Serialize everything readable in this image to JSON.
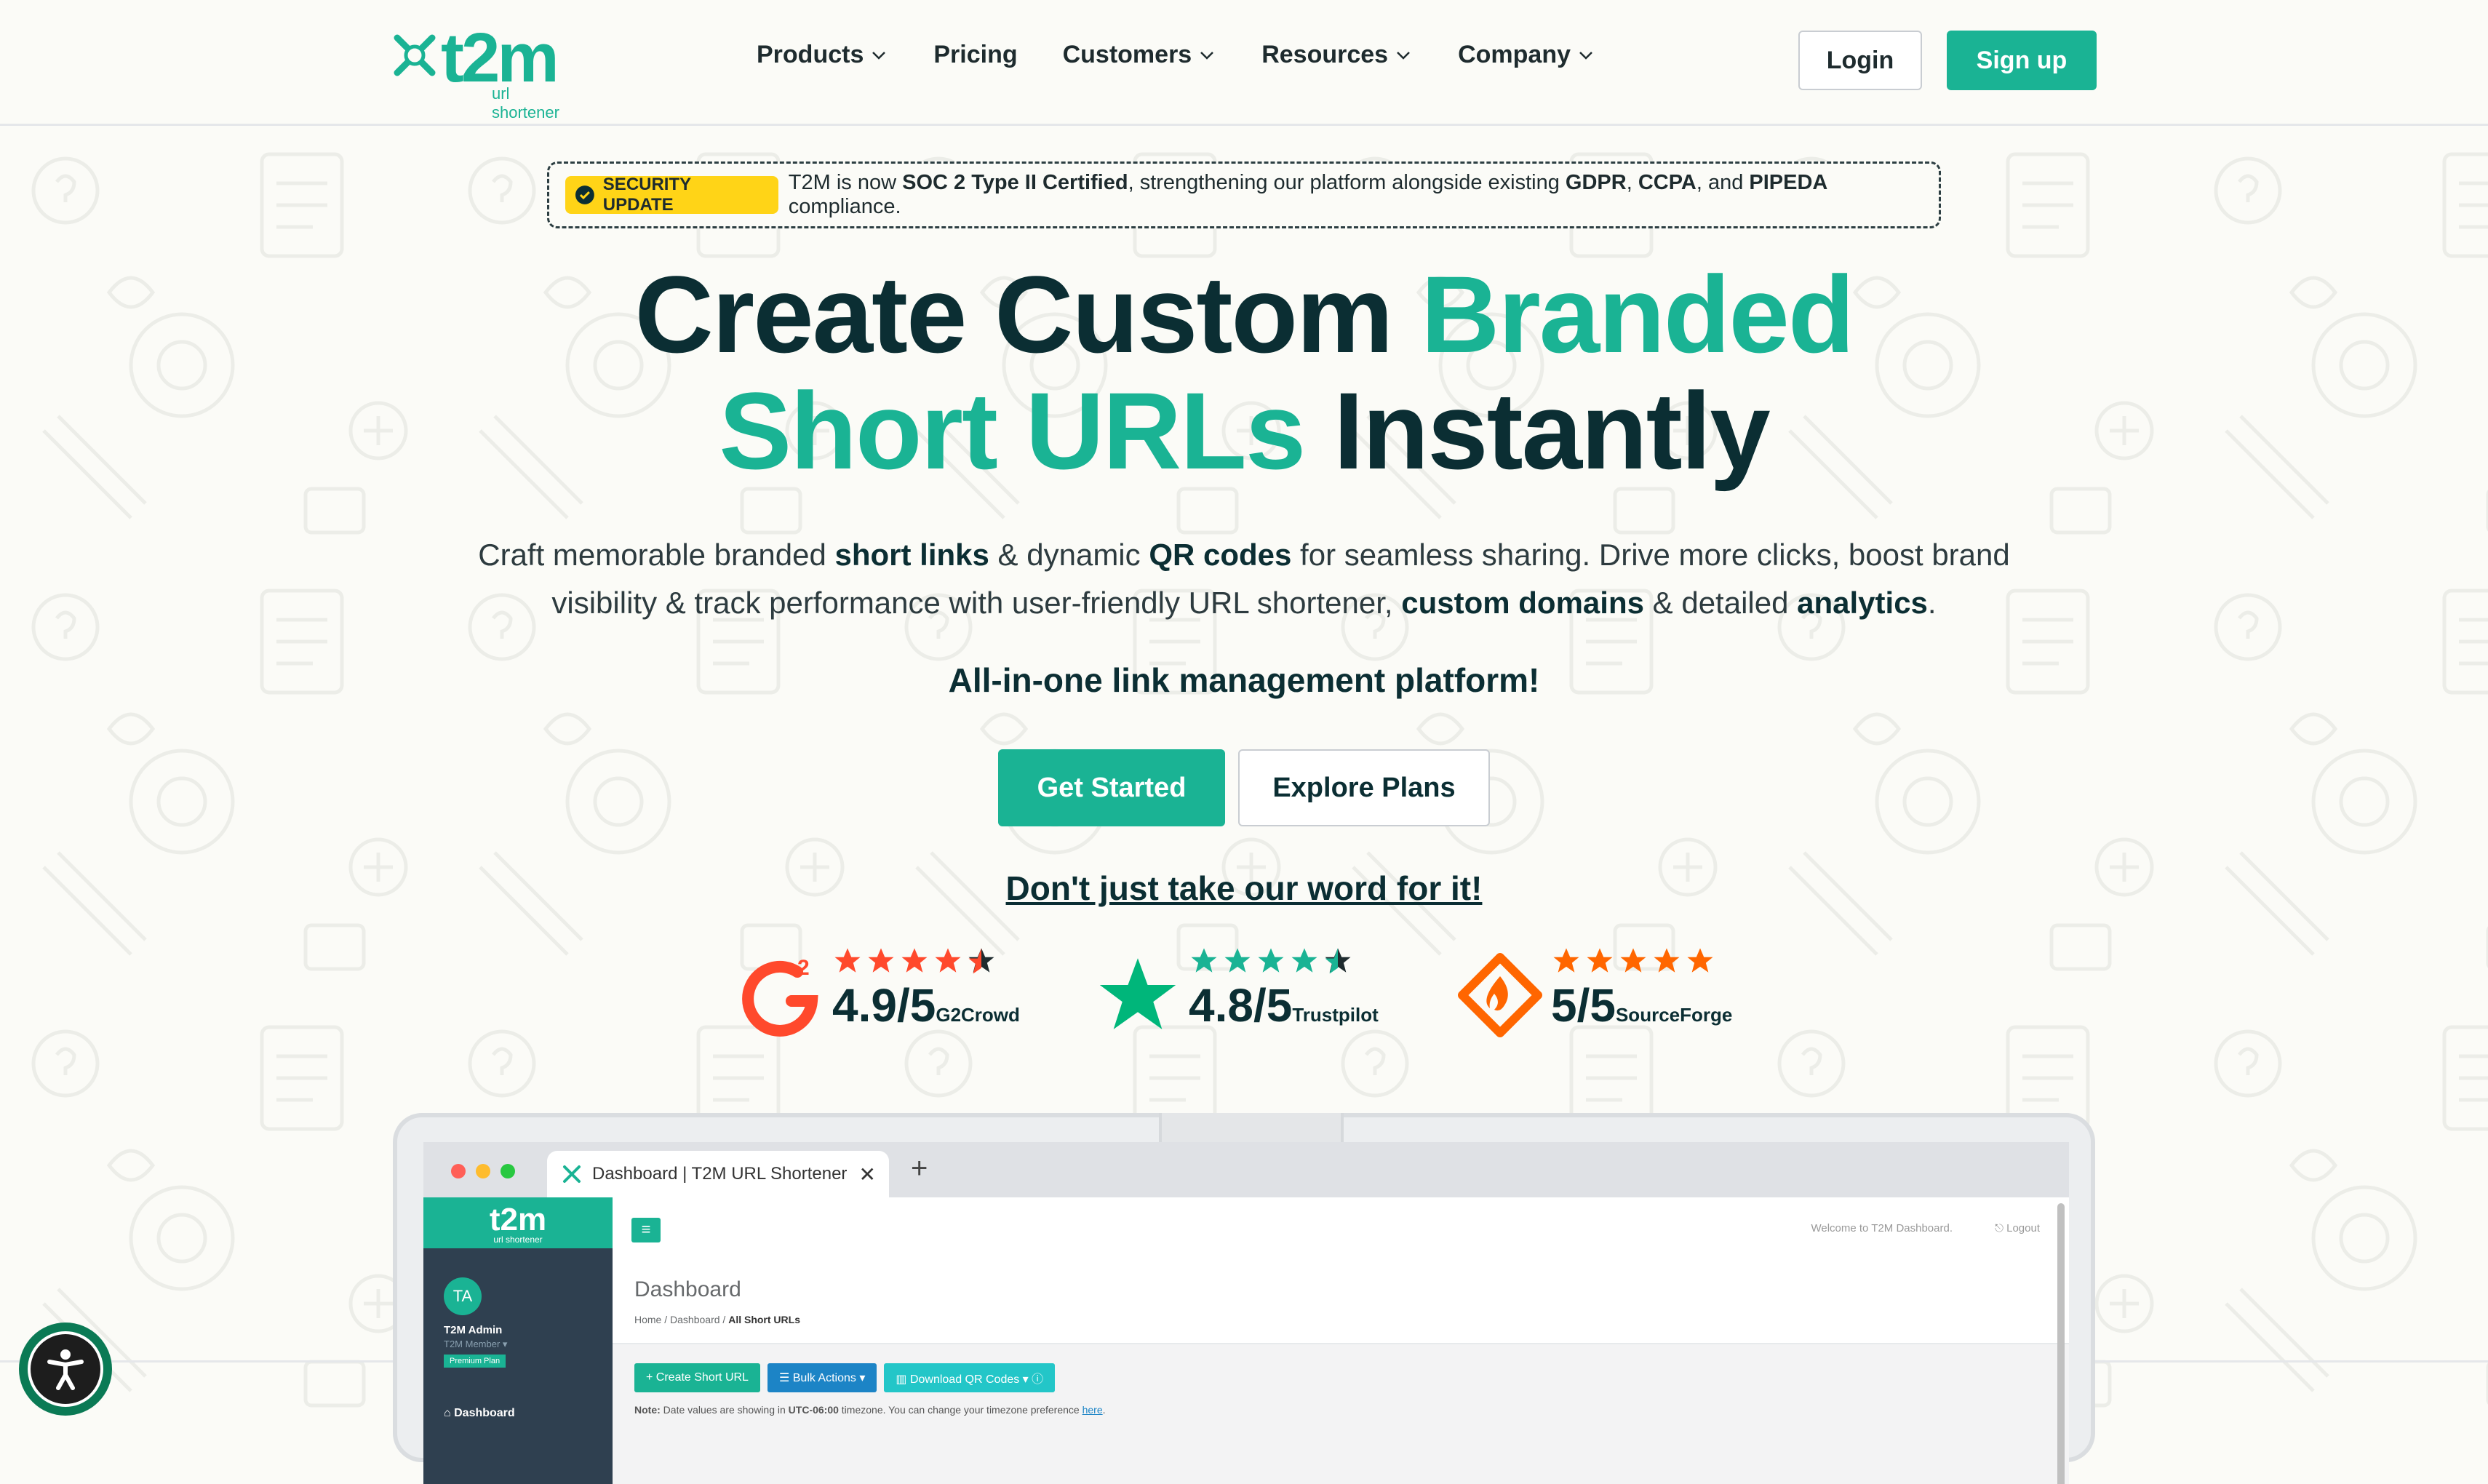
{
  "brand": {
    "name": "t2m",
    "sub": "url shortener",
    "accent": "#1ab394",
    "dark": "#0b2e33"
  },
  "nav": {
    "items": [
      {
        "label": "Products",
        "dropdown": true
      },
      {
        "label": "Pricing",
        "dropdown": false
      },
      {
        "label": "Customers",
        "dropdown": true
      },
      {
        "label": "Resources",
        "dropdown": true
      },
      {
        "label": "Company",
        "dropdown": true
      }
    ],
    "login": "Login",
    "signup": "Sign up"
  },
  "announcement": {
    "badge": "SECURITY UPDATE",
    "t1": "T2M is now ",
    "b1": "SOC 2 Type II Certified",
    "t2": ", strengthening our platform alongside existing ",
    "b2": "GDPR",
    "t3": ", ",
    "b3": "CCPA",
    "t4": ", and ",
    "b4": "PIPEDA",
    "t5": " compliance."
  },
  "hero": {
    "l1a": "Create Custom ",
    "l1b": "Branded",
    "l2a": "Short URLs",
    "l2b": " Instantly",
    "sub": {
      "t1": "Craft memorable branded ",
      "b1": "short links",
      "t2": " & dynamic ",
      "b2": "QR codes",
      "t3": " for seamless sharing. Drive more clicks, boost brand visibility & track performance with user-friendly URL shortener, ",
      "b3": "custom domains",
      "t4": " & detailed ",
      "b4": "analytics",
      "t5": "."
    },
    "tagline": "All-in-one link management platform!",
    "cta_primary": "Get Started",
    "cta_secondary": "Explore Plans",
    "proof_link": "Don't just take our word for it!"
  },
  "ratings": [
    {
      "score": "4.9/5",
      "source": "G2Crowd",
      "logo": "g2-logo-icon",
      "color": "#ff492c"
    },
    {
      "score": "4.8/5",
      "source": "Trustpilot",
      "logo": "trustpilot-star-icon",
      "color": "#00b67a"
    },
    {
      "score": "5/5",
      "source": "SourceForge",
      "logo": "sourceforge-logo-icon",
      "color": "#ff6600"
    }
  ],
  "mockup": {
    "tab_title": "Dashboard | T2M URL Shortener",
    "sidebar": {
      "logo": "t2m",
      "logo_sub": "url shortener",
      "initials": "TA",
      "name": "T2M Admin",
      "member": "T2M Member ▾",
      "plan": "Premium Plan",
      "nav_dashboard": "Dashboard"
    },
    "welcome": "Welcome to T2M Dashboard.",
    "logout": "Logout",
    "page_title": "Dashboard",
    "crumb1": "Home",
    "crumb2": "Dashboard",
    "crumb3": "All Short URLs",
    "actions": [
      {
        "label": "+ Create Short URL",
        "color": "#1ab394"
      },
      {
        "label": "☰ Bulk Actions ▾",
        "color": "#1c84c6"
      },
      {
        "label": "▥ Download QR Codes ▾ ⓘ",
        "color": "#23c6c8"
      }
    ],
    "note_label": "Note:",
    "note_text": " Date values are showing in ",
    "note_tz": "UTC-06:00",
    "note_text2": " timezone. You can change your timezone preference ",
    "note_link": "here",
    "note_end": "."
  }
}
